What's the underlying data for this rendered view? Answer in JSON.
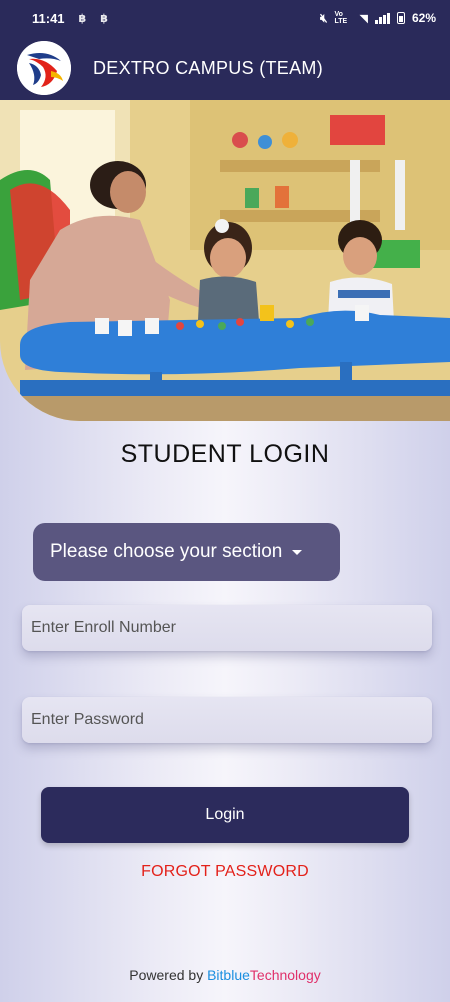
{
  "status_bar": {
    "time": "11:41",
    "notif_icons": [
      "app-notification-icon",
      "app-notification-icon"
    ],
    "network_label": "Vo LTE",
    "battery": "62%"
  },
  "app_bar": {
    "title": "DEXTRO CAMPUS (TEAM)"
  },
  "login": {
    "heading": "STUDENT LOGIN",
    "section_placeholder": "Please choose your section",
    "enroll_placeholder": "Enter Enroll Number",
    "password_placeholder": "Enter Password",
    "login_label": "Login",
    "forgot_label": "FORGOT PASSWORD"
  },
  "footer": {
    "powered_by": "Powered by",
    "brand_part1": "Bitblue",
    "brand_part2": "Technology"
  },
  "colors": {
    "primary": "#2a2a5a",
    "select_bg": "#5a5680",
    "forgot": "#e3211a",
    "brand_blue": "#1b8fe0",
    "brand_pink": "#e0306a"
  }
}
